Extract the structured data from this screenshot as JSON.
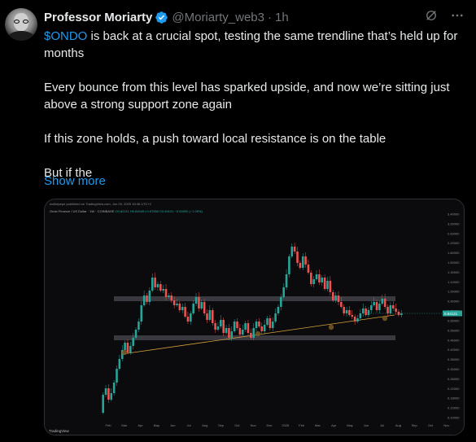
{
  "author": {
    "name": "Professor Moriarty",
    "handle": "@Moriarty_web3",
    "separator": "·",
    "time": "1h"
  },
  "tweet": {
    "cashtag": "$ONDO",
    "line1_rest": " is back at a crucial spot, testing the same trendline that’s held up for months",
    "para2": "Every bounce from this level has sparked upside, and now we’re sitting just above a strong support zone again",
    "para3": "If this zone holds, a push toward local resistance is on the table",
    "para4": "But if the",
    "show_more": "Show more"
  },
  "icons": {
    "verified": "verified-badge-icon",
    "grok": "grok-icon",
    "more": "more-options-icon"
  },
  "colors": {
    "accent": "#1d9bf0",
    "bull": "#26a69a",
    "bear": "#ef5350",
    "trend": "#d8a33a",
    "zone": "#4a4a50"
  },
  "chart": {
    "header": "wolfofpepe published on TradingView.com, Jun 09, 2025 15:46 UTC+2",
    "symbol_line": "Ondo Finance / US Dollar · 1W · COINBASE",
    "ohlc": "O0.82211 H0.84949 L0.67850 C0.84121 −0.00090 (−1.09%)",
    "logo": "TradingView",
    "price_label": "0.84121"
  },
  "chart_data": {
    "type": "candlestick",
    "x_ticks": [
      "Feb",
      "Mar",
      "Apr",
      "May",
      "Jun",
      "Jul",
      "Aug",
      "Sep",
      "Oct",
      "Nov",
      "Dec",
      "2025",
      "Feb",
      "Mar",
      "Apr",
      "May",
      "Jun",
      "Jul",
      "Aug",
      "Sep",
      "Oct",
      "Nov"
    ],
    "y_ticks": [
      "3.40000",
      "3.00000",
      "2.60000",
      "2.20000",
      "1.80000",
      "1.50000",
      "1.30000",
      "1.10000",
      "1.00000",
      "0.90000",
      "0.75000",
      "0.65000",
      "0.55000",
      "0.46000",
      "0.40000",
      "0.35000",
      "0.30000",
      "0.26000",
      "0.22000",
      "0.18000",
      "0.15000",
      "0.10000"
    ],
    "zones": [
      "resistance ~1.00",
      "support ~0.60"
    ],
    "trendline": "rising support trendline",
    "current_price": 0.84121
  }
}
